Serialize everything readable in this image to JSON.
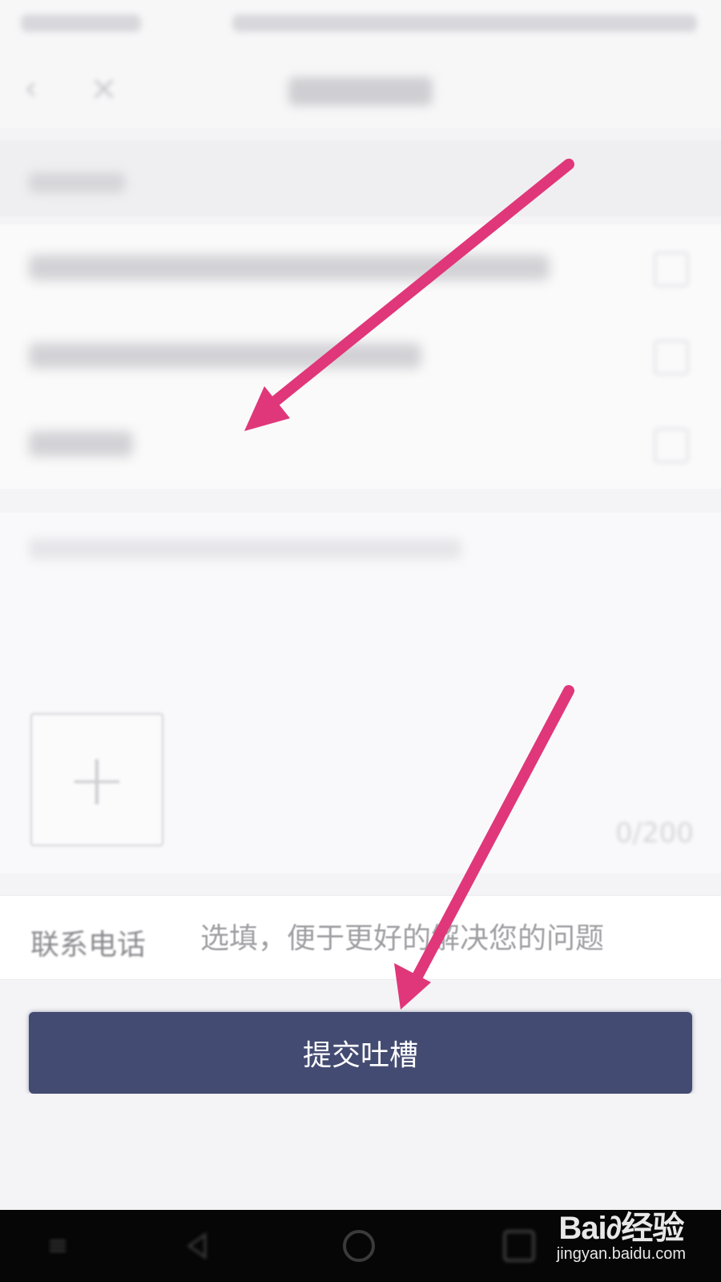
{
  "status_bar": {},
  "nav": {
    "back_icon": "chevron-left-icon",
    "close_icon": "close-icon"
  },
  "feedback": {
    "char_count": "0/200",
    "upload_icon": "plus-icon"
  },
  "contact": {
    "label": "联系电话",
    "placeholder": "选填，便于更好的解决您的问题"
  },
  "submit": {
    "label": "提交吐槽",
    "color": "#444b72"
  },
  "annotations": {
    "arrow_color": "#e0377a"
  },
  "system_nav": {
    "keys": [
      "menu-icon",
      "back-triangle-icon",
      "home-circle-icon",
      "recent-square-icon"
    ]
  },
  "watermark": {
    "logo": "Bai∂经验",
    "url": "jingyan.baidu.com"
  }
}
